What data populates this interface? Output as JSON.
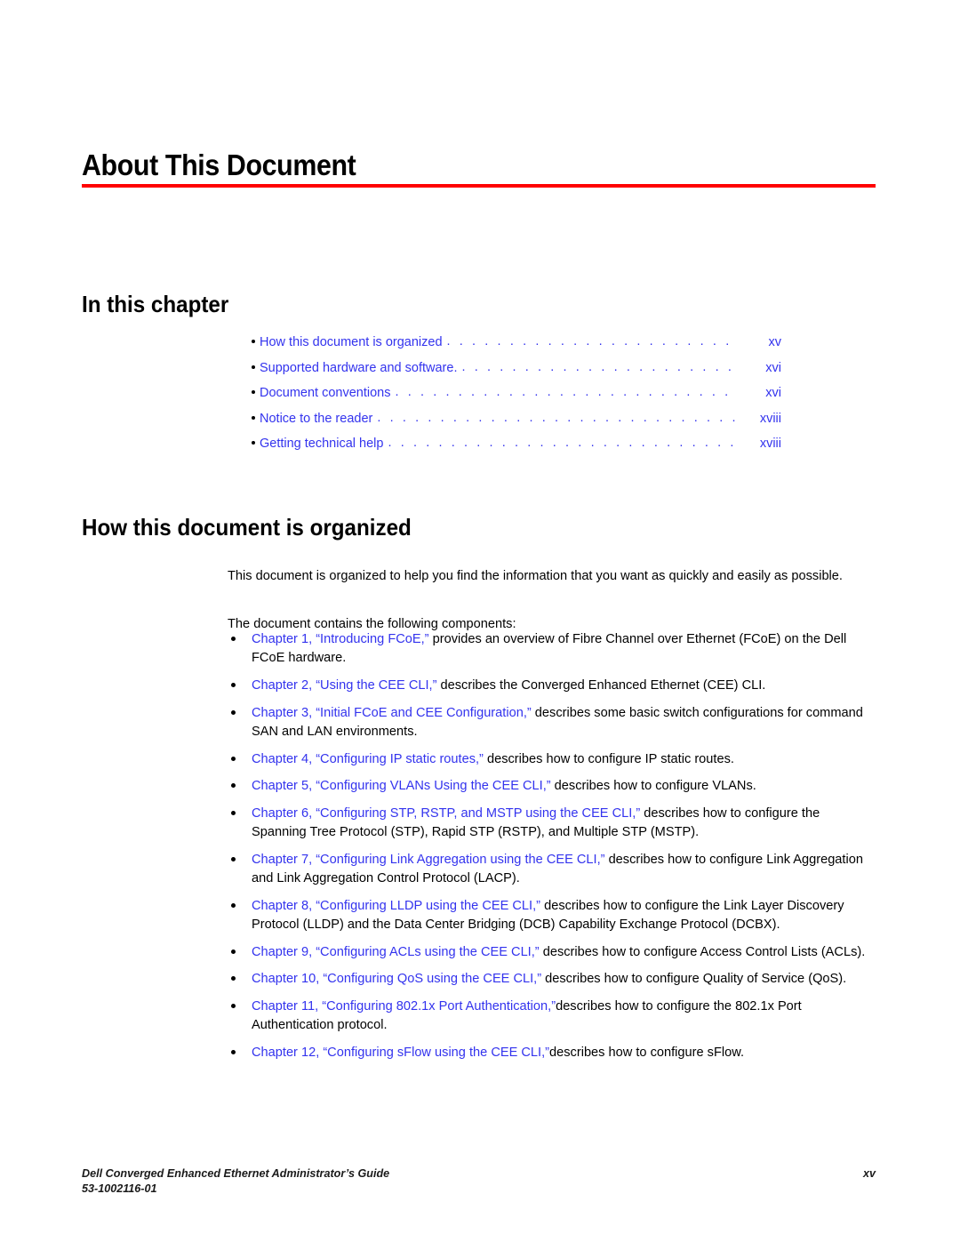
{
  "page": {
    "chapter_title": "About This Document",
    "rule_color": "#ff0000",
    "link_color": "#3333ee"
  },
  "in_this_chapter": {
    "heading": "In this chapter",
    "leader": ". . . . . . . . . . . . . . . . . . . . . . . . . . . . . . . . . . . . . . . . . . . . . . . . . . . . . . . . . . . . . . . . . .",
    "entries": [
      {
        "label": "How this document is organized",
        "page": "xv"
      },
      {
        "label": "Supported hardware and software.",
        "page": "xvi"
      },
      {
        "label": "Document conventions",
        "page": "xvi"
      },
      {
        "label": "Notice to the reader",
        "page": "xviii"
      },
      {
        "label": "Getting technical help",
        "page": "xviii"
      }
    ]
  },
  "how_organized": {
    "heading": "How this document is organized",
    "paragraph_1": "This document is organized to help you find the information that you want as quickly and easily as possible.",
    "paragraph_2": "The document contains the following components:",
    "chapters": [
      {
        "link": "Chapter 1, “Introducing FCoE,”",
        "text": " provides an overview of Fibre Channel over Ethernet (FCoE) on the Dell FCoE hardware."
      },
      {
        "link": "Chapter 2, “Using the CEE CLI,”",
        "text": " describes the Converged Enhanced Ethernet (CEE) CLI."
      },
      {
        "link": "Chapter 3, “Initial FCoE and CEE Configuration,”",
        "text": " describes some basic switch configurations for command SAN and LAN environments."
      },
      {
        "link": "Chapter 4, “Configuring IP static routes,”",
        "text": " describes how to configure IP static routes."
      },
      {
        "link": "Chapter 5, “Configuring VLANs Using the CEE CLI,”",
        "text": " describes how to configure VLANs."
      },
      {
        "link": "Chapter 6, “Configuring STP, RSTP, and MSTP using the CEE CLI,”",
        "text": " describes how to configure the Spanning Tree Protocol (STP), Rapid STP (RSTP), and Multiple STP (MSTP)."
      },
      {
        "link": "Chapter 7, “Configuring Link Aggregation using the CEE CLI,”",
        "text": " describes how to configure Link Aggregation and Link Aggregation Control Protocol (LACP)."
      },
      {
        "link": "Chapter 8, “Configuring LLDP using the CEE CLI,”",
        "text": " describes how to configure the Link Layer Discovery Protocol (LLDP) and the Data Center Bridging (DCB) Capability Exchange Protocol (DCBX)."
      },
      {
        "link": "Chapter 9, “Configuring ACLs using the CEE CLI,”",
        "text": " describes how to configure Access Control Lists (ACLs)."
      },
      {
        "link": "Chapter 10, “Configuring QoS using the CEE CLI,”",
        "text": " describes how to configure Quality of Service (QoS)."
      },
      {
        "link": "Chapter 11, “Configuring 802.1x Port Authentication,”",
        "text": "describes how to configure the 802.1x Port Authentication protocol."
      },
      {
        "link": "Chapter 12, “Configuring sFlow using the CEE CLI,”",
        "text": "describes how to configure sFlow."
      }
    ]
  },
  "footer": {
    "guide_title": "Dell Converged Enhanced Ethernet Administrator’s Guide",
    "doc_number": "53-1002116-01",
    "page_number": "xv"
  }
}
